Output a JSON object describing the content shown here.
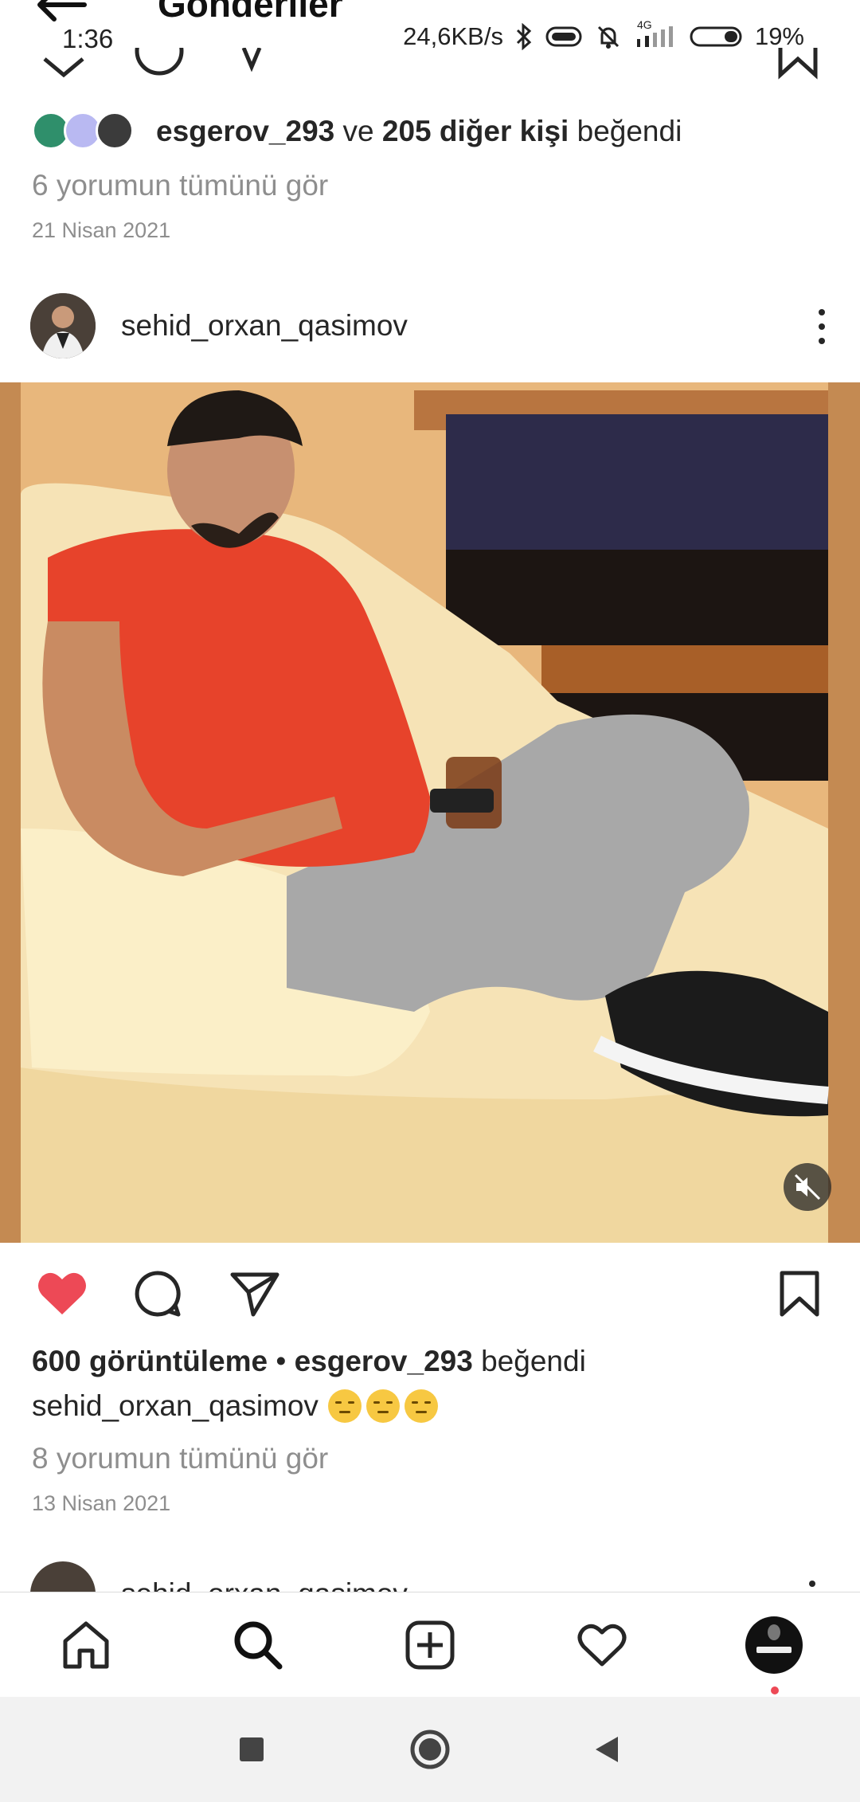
{
  "status_bar": {
    "time": "1:36",
    "net_speed": "24,6KB/s",
    "network_type": "4G",
    "battery": "19%",
    "icons": [
      "bluetooth-icon",
      "data-saver-icon",
      "mute-icon",
      "signal-icon",
      "battery-icon"
    ]
  },
  "header": {
    "title": "Gönderiler",
    "back_icon": "arrow-left-icon"
  },
  "previous_post": {
    "likes": {
      "user": "esgerov_293",
      "connector": " ve ",
      "others": "205 diğer kişi",
      "suffix": " beğendi"
    },
    "view_comments": "6 yorumun tümünü gör",
    "date": "21 Nisan 2021"
  },
  "post": {
    "username": "sehid_orxan_qasimov",
    "media_type": "video",
    "muted": true,
    "liked": true,
    "views": "600 görüntüleme",
    "separator": " • ",
    "liked_by_user": "esgerov_293",
    "liked_by_suffix": " beğendi",
    "caption_user": "sehid_orxan_qasimov",
    "caption_emojis": [
      "pensive-face-emoji",
      "pensive-face-emoji",
      "pensive-face-emoji"
    ],
    "view_comments": "8 yorumun tümünü gör",
    "date": "13 Nisan 2021"
  },
  "next_post": {
    "username": "sehid_orxan_qasimov"
  },
  "bottom_nav": {
    "items": [
      "home-icon",
      "search-icon",
      "new-post-icon",
      "activity-icon",
      "profile-avatar"
    ],
    "active": "search-icon",
    "profile_notification": true
  },
  "system_nav": {
    "buttons": [
      "recents-button",
      "home-button",
      "back-button"
    ]
  },
  "colors": {
    "like_red": "#ed4956",
    "secondary_text": "#8e8e8e",
    "primary_text": "#262626"
  }
}
